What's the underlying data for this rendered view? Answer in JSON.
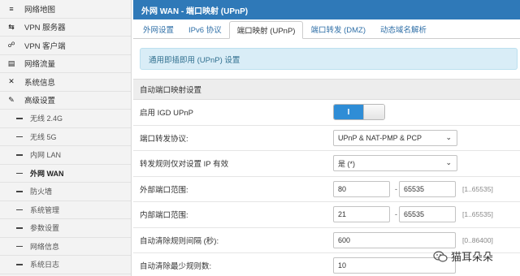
{
  "sidebar": {
    "items": [
      {
        "icon": "≡",
        "label": "网络地图"
      },
      {
        "icon": "⇆",
        "label": "VPN 服务器"
      },
      {
        "icon": "☍",
        "label": "VPN 客户端"
      },
      {
        "icon": "▤",
        "label": "网络流量"
      },
      {
        "icon": "✕",
        "label": "系统信息"
      },
      {
        "icon": "✎",
        "label": "高级设置"
      }
    ],
    "subitems": [
      "无线 2.4G",
      "无线 5G",
      "内网 LAN",
      "外网 WAN",
      "防火墙",
      "系统管理",
      "参数设置",
      "网络信息",
      "系统日志"
    ]
  },
  "titlebar": {
    "title": "外网 WAN - 端口映射 (UPnP)"
  },
  "tabs": [
    "外网设置",
    "IPv6 协议",
    "端口映射 (UPnP)",
    "端口转发 (DMZ)",
    "动态域名解析"
  ],
  "info": {
    "text": "通用即插即用 (UPnP) 设置"
  },
  "section": {
    "title": "自动端口映射设置"
  },
  "form": {
    "igd": {
      "label": "启用 IGD UPnP",
      "state": "I"
    },
    "protocol": {
      "label": "端口转发协议:",
      "value": "UPnP & NAT-PMP & PCP"
    },
    "ip_only": {
      "label": "转发规则仅对设置 IP 有效",
      "value": "是 (*)"
    },
    "external_ports": {
      "label": "外部端口范围:",
      "from": "80",
      "dash": "-",
      "to": "65535",
      "range": "[1..65535]"
    },
    "internal_ports": {
      "label": "内部端口范围:",
      "from": "21",
      "dash": "-",
      "to": "65535",
      "range": "[1..65535]"
    },
    "clean_interval": {
      "label": "自动清除规则间隔 (秒):",
      "value": "600",
      "range": "[0..86400]"
    },
    "clean_min": {
      "label": "自动清除最少规则数:",
      "value": "10"
    }
  },
  "watermark": {
    "text": "猫耳朵朵"
  },
  "colors": {
    "titlebar": "#2f79b8",
    "toggle_on": "#2f8dd6",
    "info_bg": "#d9edf7"
  }
}
